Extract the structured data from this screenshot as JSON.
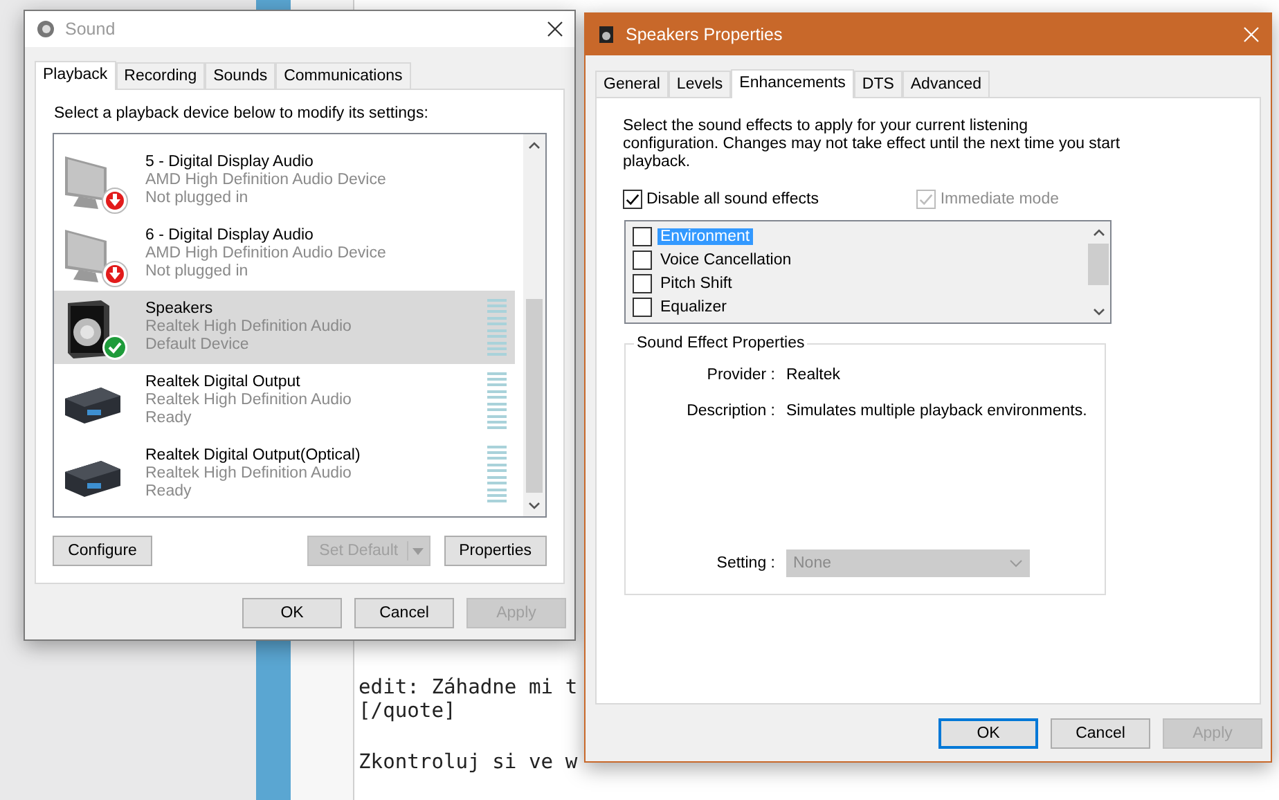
{
  "background": {
    "lines": [
      "edit: Záhadne mi t",
      "[/quote]",
      "Zkontroluj si ve w"
    ]
  },
  "sound_window": {
    "title": "Sound",
    "tabs": [
      {
        "label": "Playback",
        "selected": true
      },
      {
        "label": "Recording",
        "selected": false
      },
      {
        "label": "Sounds",
        "selected": false
      },
      {
        "label": "Communications",
        "selected": false
      }
    ],
    "instruction": "Select a playback device below to modify its settings:",
    "devices": [
      {
        "kind": "monitor",
        "unplugged": true,
        "default": false,
        "name": "5 - Digital Display Audio",
        "driver": "AMD High Definition Audio Device",
        "status": "Not plugged in",
        "meter": false,
        "selected": false
      },
      {
        "kind": "monitor",
        "unplugged": true,
        "default": false,
        "name": "6 - Digital Display Audio",
        "driver": "AMD High Definition Audio Device",
        "status": "Not plugged in",
        "meter": false,
        "selected": false
      },
      {
        "kind": "speaker",
        "unplugged": false,
        "default": true,
        "name": "Speakers",
        "driver": "Realtek High Definition Audio",
        "status": "Default Device",
        "meter": true,
        "selected": true
      },
      {
        "kind": "digital",
        "unplugged": false,
        "default": false,
        "name": "Realtek Digital Output",
        "driver": "Realtek High Definition Audio",
        "status": "Ready",
        "meter": true,
        "selected": false
      },
      {
        "kind": "digital",
        "unplugged": false,
        "default": false,
        "name": "Realtek Digital Output(Optical)",
        "driver": "Realtek High Definition Audio",
        "status": "Ready",
        "meter": true,
        "selected": false
      }
    ],
    "configure": {
      "label": "Configure",
      "disabled": false
    },
    "set_default": {
      "label": "Set Default",
      "disabled": true
    },
    "properties": {
      "label": "Properties",
      "disabled": false
    },
    "footer": [
      {
        "label": "OK",
        "disabled": false
      },
      {
        "label": "Cancel",
        "disabled": false
      },
      {
        "label": "Apply",
        "disabled": true
      }
    ]
  },
  "speakers_window": {
    "title": "Speakers Properties",
    "tabs": [
      {
        "label": "General",
        "selected": false
      },
      {
        "label": "Levels",
        "selected": false
      },
      {
        "label": "Enhancements",
        "selected": true
      },
      {
        "label": "DTS",
        "selected": false
      },
      {
        "label": "Advanced",
        "selected": false
      }
    ],
    "intro": "Select the sound effects to apply for your current listening configuration. Changes may not take effect until the next time you start playback.",
    "disable_all": {
      "label": "Disable all sound effects",
      "checked": true,
      "disabled": false
    },
    "immediate_mode": {
      "label": "Immediate mode",
      "checked": true,
      "disabled": true
    },
    "effects": [
      {
        "label": "Environment",
        "checked": false,
        "selected": true
      },
      {
        "label": "Voice Cancellation",
        "checked": false,
        "selected": false
      },
      {
        "label": "Pitch Shift",
        "checked": false,
        "selected": false
      },
      {
        "label": "Equalizer",
        "checked": false,
        "selected": false
      }
    ],
    "group": {
      "title": "Sound Effect Properties",
      "provider_label": "Provider :",
      "provider": "Realtek",
      "description_label": "Description :",
      "description": "Simulates multiple playback environments.",
      "setting_label": "Setting :",
      "setting": {
        "value": "None",
        "disabled": true
      }
    },
    "footer": [
      {
        "label": "OK",
        "disabled": false,
        "default": true
      },
      {
        "label": "Cancel",
        "disabled": false,
        "default": false
      },
      {
        "label": "Apply",
        "disabled": true,
        "default": false
      }
    ]
  }
}
